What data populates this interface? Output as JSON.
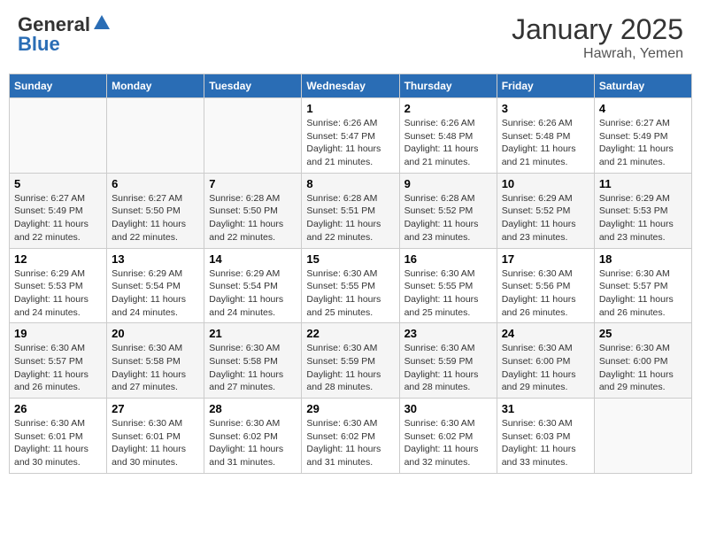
{
  "header": {
    "logo_general": "General",
    "logo_blue": "Blue",
    "month_title": "January 2025",
    "location": "Hawrah, Yemen"
  },
  "weekdays": [
    "Sunday",
    "Monday",
    "Tuesday",
    "Wednesday",
    "Thursday",
    "Friday",
    "Saturday"
  ],
  "weeks": [
    [
      {
        "day": "",
        "info": ""
      },
      {
        "day": "",
        "info": ""
      },
      {
        "day": "",
        "info": ""
      },
      {
        "day": "1",
        "info": "Sunrise: 6:26 AM\nSunset: 5:47 PM\nDaylight: 11 hours and 21 minutes."
      },
      {
        "day": "2",
        "info": "Sunrise: 6:26 AM\nSunset: 5:48 PM\nDaylight: 11 hours and 21 minutes."
      },
      {
        "day": "3",
        "info": "Sunrise: 6:26 AM\nSunset: 5:48 PM\nDaylight: 11 hours and 21 minutes."
      },
      {
        "day": "4",
        "info": "Sunrise: 6:27 AM\nSunset: 5:49 PM\nDaylight: 11 hours and 21 minutes."
      }
    ],
    [
      {
        "day": "5",
        "info": "Sunrise: 6:27 AM\nSunset: 5:49 PM\nDaylight: 11 hours and 22 minutes."
      },
      {
        "day": "6",
        "info": "Sunrise: 6:27 AM\nSunset: 5:50 PM\nDaylight: 11 hours and 22 minutes."
      },
      {
        "day": "7",
        "info": "Sunrise: 6:28 AM\nSunset: 5:50 PM\nDaylight: 11 hours and 22 minutes."
      },
      {
        "day": "8",
        "info": "Sunrise: 6:28 AM\nSunset: 5:51 PM\nDaylight: 11 hours and 22 minutes."
      },
      {
        "day": "9",
        "info": "Sunrise: 6:28 AM\nSunset: 5:52 PM\nDaylight: 11 hours and 23 minutes."
      },
      {
        "day": "10",
        "info": "Sunrise: 6:29 AM\nSunset: 5:52 PM\nDaylight: 11 hours and 23 minutes."
      },
      {
        "day": "11",
        "info": "Sunrise: 6:29 AM\nSunset: 5:53 PM\nDaylight: 11 hours and 23 minutes."
      }
    ],
    [
      {
        "day": "12",
        "info": "Sunrise: 6:29 AM\nSunset: 5:53 PM\nDaylight: 11 hours and 24 minutes."
      },
      {
        "day": "13",
        "info": "Sunrise: 6:29 AM\nSunset: 5:54 PM\nDaylight: 11 hours and 24 minutes."
      },
      {
        "day": "14",
        "info": "Sunrise: 6:29 AM\nSunset: 5:54 PM\nDaylight: 11 hours and 24 minutes."
      },
      {
        "day": "15",
        "info": "Sunrise: 6:30 AM\nSunset: 5:55 PM\nDaylight: 11 hours and 25 minutes."
      },
      {
        "day": "16",
        "info": "Sunrise: 6:30 AM\nSunset: 5:55 PM\nDaylight: 11 hours and 25 minutes."
      },
      {
        "day": "17",
        "info": "Sunrise: 6:30 AM\nSunset: 5:56 PM\nDaylight: 11 hours and 26 minutes."
      },
      {
        "day": "18",
        "info": "Sunrise: 6:30 AM\nSunset: 5:57 PM\nDaylight: 11 hours and 26 minutes."
      }
    ],
    [
      {
        "day": "19",
        "info": "Sunrise: 6:30 AM\nSunset: 5:57 PM\nDaylight: 11 hours and 26 minutes."
      },
      {
        "day": "20",
        "info": "Sunrise: 6:30 AM\nSunset: 5:58 PM\nDaylight: 11 hours and 27 minutes."
      },
      {
        "day": "21",
        "info": "Sunrise: 6:30 AM\nSunset: 5:58 PM\nDaylight: 11 hours and 27 minutes."
      },
      {
        "day": "22",
        "info": "Sunrise: 6:30 AM\nSunset: 5:59 PM\nDaylight: 11 hours and 28 minutes."
      },
      {
        "day": "23",
        "info": "Sunrise: 6:30 AM\nSunset: 5:59 PM\nDaylight: 11 hours and 28 minutes."
      },
      {
        "day": "24",
        "info": "Sunrise: 6:30 AM\nSunset: 6:00 PM\nDaylight: 11 hours and 29 minutes."
      },
      {
        "day": "25",
        "info": "Sunrise: 6:30 AM\nSunset: 6:00 PM\nDaylight: 11 hours and 29 minutes."
      }
    ],
    [
      {
        "day": "26",
        "info": "Sunrise: 6:30 AM\nSunset: 6:01 PM\nDaylight: 11 hours and 30 minutes."
      },
      {
        "day": "27",
        "info": "Sunrise: 6:30 AM\nSunset: 6:01 PM\nDaylight: 11 hours and 30 minutes."
      },
      {
        "day": "28",
        "info": "Sunrise: 6:30 AM\nSunset: 6:02 PM\nDaylight: 11 hours and 31 minutes."
      },
      {
        "day": "29",
        "info": "Sunrise: 6:30 AM\nSunset: 6:02 PM\nDaylight: 11 hours and 31 minutes."
      },
      {
        "day": "30",
        "info": "Sunrise: 6:30 AM\nSunset: 6:02 PM\nDaylight: 11 hours and 32 minutes."
      },
      {
        "day": "31",
        "info": "Sunrise: 6:30 AM\nSunset: 6:03 PM\nDaylight: 11 hours and 33 minutes."
      },
      {
        "day": "",
        "info": ""
      }
    ]
  ]
}
